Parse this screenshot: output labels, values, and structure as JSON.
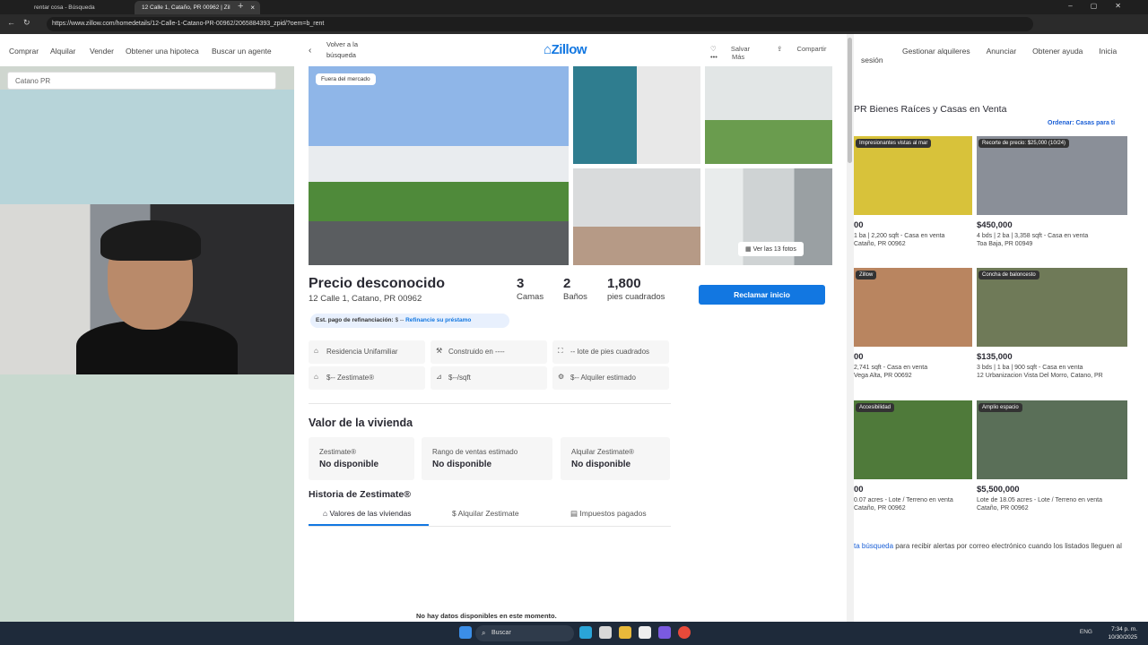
{
  "browser": {
    "tabs": [
      {
        "label": "rentar cosa - Búsqueda"
      },
      {
        "label": "12 Calle 1, Cataño, PR 00962 | Zil"
      }
    ],
    "url": "https://www.zillow.com/homedetails/12-Calle-1-Catano-PR-00962/2065884393_zpid/?oem=b_rent"
  },
  "bg_site": {
    "nav": [
      "Comprar",
      "Alquilar",
      "Vender",
      "Obtener una hipoteca",
      "Buscar un agente"
    ],
    "search_value": "Catano PR",
    "right_nav": [
      "Gestionar alquileres",
      "Anunciar",
      "Obtener ayuda",
      "Inicia sesión"
    ],
    "results_title": "PR Bienes Raíces y Casas en Venta",
    "sort_label": "Ordenar: Casas para ti",
    "listings": [
      {
        "badge": "Impresionantes vistas al mar",
        "price": "00",
        "line1": "1 ba | 2,200 sqft - Casa en venta",
        "line2": "Cataño, PR 00962"
      },
      {
        "badge": "Recorte de precio: $25,000 (10/24)",
        "price": "$450,000",
        "line1": "4 bds | 2 ba | 3,358 sqft - Casa en venta",
        "line2": "Toa Baja, PR 00949"
      },
      {
        "badge": "Zillow",
        "price": "00",
        "line1": "2,741 sqft - Casa en venta",
        "line2": "Vega Alta, PR 00692"
      },
      {
        "badge": "Concha de baloncesto",
        "price": "$135,000",
        "line1": "3 bds | 1 ba | 900 sqft - Casa en venta",
        "line2": "12 Urbanizacion Vista Del Morro, Catano, PR"
      },
      {
        "badge": "Accesibilidad",
        "price": "00",
        "line1": "0.07 acres - Lote / Terreno en venta",
        "line2": "Cataño, PR 00962"
      },
      {
        "badge": "Amplio espacio",
        "price": "$5,500,000",
        "line1": "Lote de 18.05 acres - Lote / Terreno en venta",
        "line2": "Cataño, PR 00962"
      }
    ],
    "alert_link": "ta búsqueda",
    "alert_text": " para recibir alertas por correo electrónico cuando los listados lleguen al"
  },
  "modal": {
    "back_label": "Volver a la búsqueda",
    "logo": "Zillow",
    "save": "Salvar",
    "share": "Compartir",
    "more": "Más",
    "off_market": "Fuera del mercado",
    "see_photos": "Ver las 13 fotos",
    "price": "Precio desconocido",
    "address": "12 Calle 1, Catano, PR 00962",
    "beds_n": "3",
    "beds_u": "Camas",
    "baths_n": "2",
    "baths_u": "Baños",
    "sqft_n": "1,800",
    "sqft_u": "pies cuadrados",
    "refi_label": "Est. pago de refinanciación:",
    "refi_value": "$ --",
    "refi_link": "Refinancie su préstamo",
    "claim_button": "Reclamar inicio",
    "facts": [
      "Residencia Unifamiliar",
      "Construido en ----",
      "-- lote de pies cuadrados",
      "$-- Zestimate®",
      "$--/sqft",
      "$-- Alquiler estimado"
    ],
    "home_value_heading": "Valor de la vivienda",
    "zestimate_label": "Zestimate®",
    "zestimate_value": "No disponible",
    "range_label": "Rango de ventas estimado",
    "range_value": "No disponible",
    "rent_label": "Alquilar Zestimate®",
    "rent_value": "No disponible",
    "history_heading": "Historia de Zestimate®",
    "history_tabs": [
      "Valores de las viviendas",
      "Alquilar Zestimate",
      "Impuestos pagados"
    ],
    "no_data": "No hay datos disponibles en este momento."
  },
  "taskbar": {
    "search": "Buscar",
    "lang": "ENG",
    "time": "7:34 p. m.",
    "date": "10/30/2025"
  }
}
